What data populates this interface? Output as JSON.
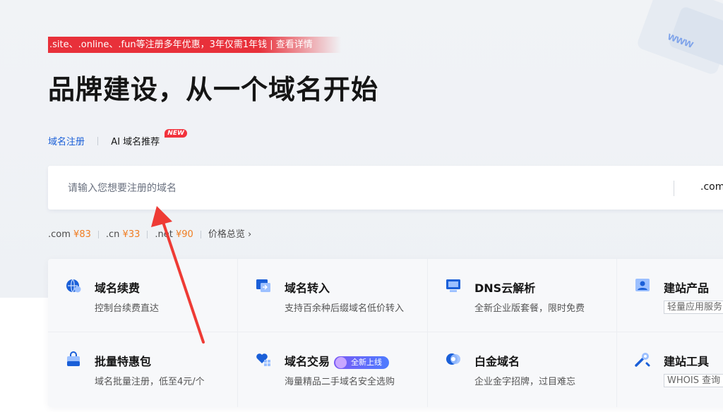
{
  "promo": {
    "text": ".site、.online、.fun等注册多年优惠，3年仅需1年钱 | 查看详情"
  },
  "headline": "品牌建设，从一个域名开始",
  "tabs": {
    "register": "域名注册",
    "ai": "AI 域名推荐",
    "ai_badge": "NEW"
  },
  "search": {
    "placeholder": "请输入您想要注册的域名",
    "suffix": ".com"
  },
  "prices": {
    "items": [
      {
        "tld": ".com",
        "price": "¥83"
      },
      {
        "tld": ".cn",
        "price": "¥33"
      },
      {
        "tld": ".net",
        "price": "¥90"
      }
    ],
    "overview": "价格总览"
  },
  "services": [
    {
      "title": "域名续费",
      "desc": "控制台续费直达",
      "icon": "globe-renew-icon"
    },
    {
      "title": "域名转入",
      "desc": "支持百余种后缀域名低价转入",
      "icon": "transfer-in-icon"
    },
    {
      "title": "DNS云解析",
      "desc": "全新企业版套餐，限时免费",
      "icon": "dns-monitor-icon"
    },
    {
      "title": "建站产品",
      "desc": "轻量应用服务",
      "icon": "site-product-icon"
    },
    {
      "title": "批量特惠包",
      "desc": "域名批量注册，低至4元/个",
      "icon": "bag-icon"
    },
    {
      "title": "域名交易",
      "desc": "海量精品二手域名安全选购",
      "icon": "heart-trade-icon",
      "badge": "全新上线"
    },
    {
      "title": "白金域名",
      "desc": "企业金字招牌，过目难忘",
      "icon": "platinum-icon"
    },
    {
      "title": "建站工具",
      "desc": "WHOIS 查询",
      "icon": "tools-icon"
    }
  ],
  "colors": {
    "accent": "#1a5fd8",
    "promo": "#e8303a",
    "price": "#f07d22",
    "annotation_arrow": "#ee3b35"
  }
}
